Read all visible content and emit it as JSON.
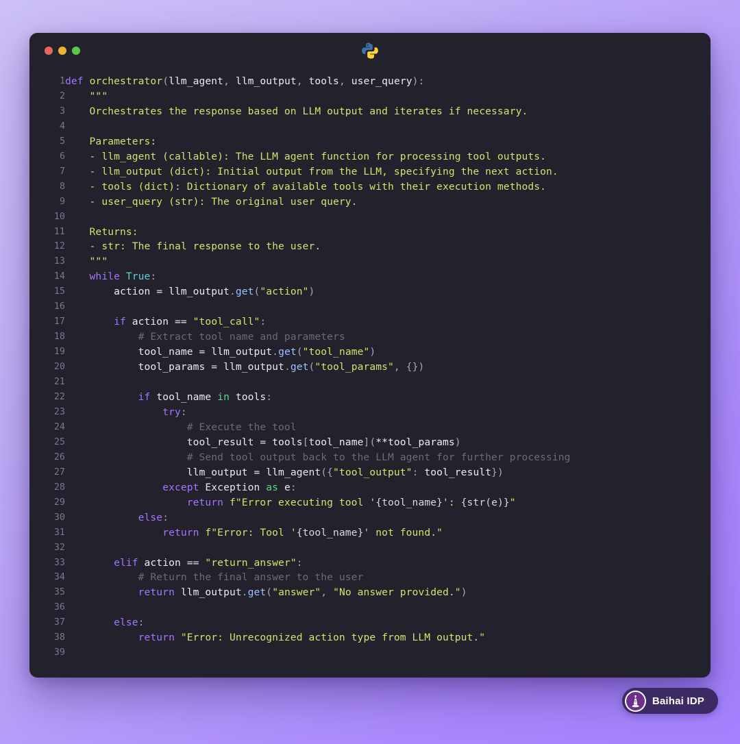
{
  "window": {
    "title_logo": "python-logo",
    "traffic_lights": [
      {
        "name": "close-button",
        "color": "#e9665f"
      },
      {
        "name": "minimize-button",
        "color": "#f0b232"
      },
      {
        "name": "maximize-button",
        "color": "#5bc745"
      }
    ]
  },
  "theme": {
    "background_gradient_from": "#ccc0f7",
    "background_gradient_to": "#a382fd",
    "window_background": "#22212c",
    "keyword_color": "#a277ff",
    "string_color": "#d6e26b",
    "comment_color": "#6d6a7c",
    "text_color": "#e2e0ea",
    "line_number_color": "#7b7990"
  },
  "watermark": {
    "label": "Baihai IDP",
    "icon": "lighthouse-icon",
    "pill_color": "#3b2a63"
  },
  "editor": {
    "language": "python",
    "total_lines": 39,
    "lines": [
      {
        "n": 1,
        "tokens": [
          {
            "t": "def",
            "c": "kw"
          },
          {
            "t": " ",
            "c": "var"
          },
          {
            "t": "orchestrator",
            "c": "fn"
          },
          {
            "t": "(",
            "c": "pun"
          },
          {
            "t": "llm_agent",
            "c": "var"
          },
          {
            "t": ", ",
            "c": "pun"
          },
          {
            "t": "llm_output",
            "c": "var"
          },
          {
            "t": ", ",
            "c": "pun"
          },
          {
            "t": "tools",
            "c": "var"
          },
          {
            "t": ", ",
            "c": "pun"
          },
          {
            "t": "user_query",
            "c": "var"
          },
          {
            "t": ")",
            "c": "pun"
          },
          {
            "t": ":",
            "c": "pun"
          }
        ]
      },
      {
        "n": 2,
        "tokens": [
          {
            "t": "    \"\"\"",
            "c": "str"
          }
        ]
      },
      {
        "n": 3,
        "tokens": [
          {
            "t": "    Orchestrates the response based on LLM output and iterates if necessary.",
            "c": "str"
          }
        ]
      },
      {
        "n": 4,
        "tokens": [
          {
            "t": "",
            "c": "str"
          }
        ]
      },
      {
        "n": 5,
        "tokens": [
          {
            "t": "    Parameters:",
            "c": "str"
          }
        ]
      },
      {
        "n": 6,
        "tokens": [
          {
            "t": "    - llm_agent (callable): The LLM agent function for processing tool outputs.",
            "c": "str"
          }
        ]
      },
      {
        "n": 7,
        "tokens": [
          {
            "t": "    - llm_output (dict): Initial output from the LLM, specifying the next action.",
            "c": "str"
          }
        ]
      },
      {
        "n": 8,
        "tokens": [
          {
            "t": "    - tools (dict): Dictionary of available tools with their execution methods.",
            "c": "str"
          }
        ]
      },
      {
        "n": 9,
        "tokens": [
          {
            "t": "    - user_query (str): The original user query.",
            "c": "str"
          }
        ]
      },
      {
        "n": 10,
        "tokens": [
          {
            "t": "",
            "c": "str"
          }
        ]
      },
      {
        "n": 11,
        "tokens": [
          {
            "t": "    Returns:",
            "c": "str"
          }
        ]
      },
      {
        "n": 12,
        "tokens": [
          {
            "t": "    - str: The final response to the user.",
            "c": "str"
          }
        ]
      },
      {
        "n": 13,
        "tokens": [
          {
            "t": "    \"\"\"",
            "c": "str"
          }
        ]
      },
      {
        "n": 14,
        "tokens": [
          {
            "t": "    ",
            "c": "var"
          },
          {
            "t": "while",
            "c": "kw"
          },
          {
            "t": " ",
            "c": "var"
          },
          {
            "t": "True",
            "c": "bi"
          },
          {
            "t": ":",
            "c": "pun"
          }
        ]
      },
      {
        "n": 15,
        "tokens": [
          {
            "t": "        ",
            "c": "var"
          },
          {
            "t": "action",
            "c": "var"
          },
          {
            "t": " ",
            "c": "var"
          },
          {
            "t": "=",
            "c": "op"
          },
          {
            "t": " ",
            "c": "var"
          },
          {
            "t": "llm_output",
            "c": "var"
          },
          {
            "t": ".",
            "c": "pun"
          },
          {
            "t": "get",
            "c": "meth"
          },
          {
            "t": "(",
            "c": "pun"
          },
          {
            "t": "\"action\"",
            "c": "str"
          },
          {
            "t": ")",
            "c": "pun"
          }
        ]
      },
      {
        "n": 16,
        "tokens": [
          {
            "t": "",
            "c": "var"
          }
        ]
      },
      {
        "n": 17,
        "tokens": [
          {
            "t": "        ",
            "c": "var"
          },
          {
            "t": "if",
            "c": "kw"
          },
          {
            "t": " ",
            "c": "var"
          },
          {
            "t": "action",
            "c": "var"
          },
          {
            "t": " ",
            "c": "var"
          },
          {
            "t": "==",
            "c": "op"
          },
          {
            "t": " ",
            "c": "var"
          },
          {
            "t": "\"tool_call\"",
            "c": "str"
          },
          {
            "t": ":",
            "c": "pun"
          }
        ]
      },
      {
        "n": 18,
        "tokens": [
          {
            "t": "            # Extract tool name and parameters",
            "c": "com"
          }
        ]
      },
      {
        "n": 19,
        "tokens": [
          {
            "t": "            ",
            "c": "var"
          },
          {
            "t": "tool_name",
            "c": "var"
          },
          {
            "t": " ",
            "c": "var"
          },
          {
            "t": "=",
            "c": "op"
          },
          {
            "t": " ",
            "c": "var"
          },
          {
            "t": "llm_output",
            "c": "var"
          },
          {
            "t": ".",
            "c": "pun"
          },
          {
            "t": "get",
            "c": "meth"
          },
          {
            "t": "(",
            "c": "pun"
          },
          {
            "t": "\"tool_name\"",
            "c": "str"
          },
          {
            "t": ")",
            "c": "pun"
          }
        ]
      },
      {
        "n": 20,
        "tokens": [
          {
            "t": "            ",
            "c": "var"
          },
          {
            "t": "tool_params",
            "c": "var"
          },
          {
            "t": " ",
            "c": "var"
          },
          {
            "t": "=",
            "c": "op"
          },
          {
            "t": " ",
            "c": "var"
          },
          {
            "t": "llm_output",
            "c": "var"
          },
          {
            "t": ".",
            "c": "pun"
          },
          {
            "t": "get",
            "c": "meth"
          },
          {
            "t": "(",
            "c": "pun"
          },
          {
            "t": "\"tool_params\"",
            "c": "str"
          },
          {
            "t": ", ",
            "c": "pun"
          },
          {
            "t": "{}",
            "c": "pun"
          },
          {
            "t": ")",
            "c": "pun"
          }
        ]
      },
      {
        "n": 21,
        "tokens": [
          {
            "t": "",
            "c": "var"
          }
        ]
      },
      {
        "n": 22,
        "tokens": [
          {
            "t": "            ",
            "c": "var"
          },
          {
            "t": "if",
            "c": "kw"
          },
          {
            "t": " ",
            "c": "var"
          },
          {
            "t": "tool_name",
            "c": "var"
          },
          {
            "t": " ",
            "c": "var"
          },
          {
            "t": "in",
            "c": "kw2"
          },
          {
            "t": " ",
            "c": "var"
          },
          {
            "t": "tools",
            "c": "var"
          },
          {
            "t": ":",
            "c": "pun"
          }
        ]
      },
      {
        "n": 23,
        "tokens": [
          {
            "t": "                ",
            "c": "var"
          },
          {
            "t": "try",
            "c": "kw"
          },
          {
            "t": ":",
            "c": "pun"
          }
        ]
      },
      {
        "n": 24,
        "tokens": [
          {
            "t": "                    # Execute the tool",
            "c": "com"
          }
        ]
      },
      {
        "n": 25,
        "tokens": [
          {
            "t": "                    ",
            "c": "var"
          },
          {
            "t": "tool_result",
            "c": "var"
          },
          {
            "t": " ",
            "c": "var"
          },
          {
            "t": "=",
            "c": "op"
          },
          {
            "t": " ",
            "c": "var"
          },
          {
            "t": "tools",
            "c": "var"
          },
          {
            "t": "[",
            "c": "pun"
          },
          {
            "t": "tool_name",
            "c": "var"
          },
          {
            "t": "]",
            "c": "pun"
          },
          {
            "t": "(",
            "c": "pun"
          },
          {
            "t": "**",
            "c": "op"
          },
          {
            "t": "tool_params",
            "c": "var"
          },
          {
            "t": ")",
            "c": "pun"
          }
        ]
      },
      {
        "n": 26,
        "tokens": [
          {
            "t": "                    # Send tool output back to the LLM agent for further processing",
            "c": "com"
          }
        ]
      },
      {
        "n": 27,
        "tokens": [
          {
            "t": "                    ",
            "c": "var"
          },
          {
            "t": "llm_output",
            "c": "var"
          },
          {
            "t": " ",
            "c": "var"
          },
          {
            "t": "=",
            "c": "op"
          },
          {
            "t": " ",
            "c": "var"
          },
          {
            "t": "llm_agent",
            "c": "var"
          },
          {
            "t": "({",
            "c": "pun"
          },
          {
            "t": "\"tool_output\"",
            "c": "str"
          },
          {
            "t": ": ",
            "c": "pun"
          },
          {
            "t": "tool_result",
            "c": "var"
          },
          {
            "t": "})",
            "c": "pun"
          }
        ]
      },
      {
        "n": 28,
        "tokens": [
          {
            "t": "                ",
            "c": "var"
          },
          {
            "t": "except",
            "c": "kw"
          },
          {
            "t": " ",
            "c": "var"
          },
          {
            "t": "Exception",
            "c": "cls"
          },
          {
            "t": " ",
            "c": "var"
          },
          {
            "t": "as",
            "c": "kw2"
          },
          {
            "t": " ",
            "c": "var"
          },
          {
            "t": "e",
            "c": "var"
          },
          {
            "t": ":",
            "c": "pun"
          }
        ]
      },
      {
        "n": 29,
        "tokens": [
          {
            "t": "                    ",
            "c": "var"
          },
          {
            "t": "return",
            "c": "kw"
          },
          {
            "t": " ",
            "c": "var"
          },
          {
            "t": "f\"Error executing tool '",
            "c": "str"
          },
          {
            "t": "{tool_name}",
            "c": "fexp"
          },
          {
            "t": "': ",
            "c": "str"
          },
          {
            "t": "{str(e)}",
            "c": "fexp"
          },
          {
            "t": "\"",
            "c": "str"
          }
        ]
      },
      {
        "n": 30,
        "tokens": [
          {
            "t": "            ",
            "c": "var"
          },
          {
            "t": "else",
            "c": "kw"
          },
          {
            "t": ":",
            "c": "pun"
          }
        ]
      },
      {
        "n": 31,
        "tokens": [
          {
            "t": "                ",
            "c": "var"
          },
          {
            "t": "return",
            "c": "kw"
          },
          {
            "t": " ",
            "c": "var"
          },
          {
            "t": "f\"Error: Tool '",
            "c": "str"
          },
          {
            "t": "{tool_name}",
            "c": "fexp"
          },
          {
            "t": "' not found.\"",
            "c": "str"
          }
        ]
      },
      {
        "n": 32,
        "tokens": [
          {
            "t": "",
            "c": "var"
          }
        ]
      },
      {
        "n": 33,
        "tokens": [
          {
            "t": "        ",
            "c": "var"
          },
          {
            "t": "elif",
            "c": "kw"
          },
          {
            "t": " ",
            "c": "var"
          },
          {
            "t": "action",
            "c": "var"
          },
          {
            "t": " ",
            "c": "var"
          },
          {
            "t": "==",
            "c": "op"
          },
          {
            "t": " ",
            "c": "var"
          },
          {
            "t": "\"return_answer\"",
            "c": "str"
          },
          {
            "t": ":",
            "c": "pun"
          }
        ]
      },
      {
        "n": 34,
        "tokens": [
          {
            "t": "            # Return the final answer to the user",
            "c": "com"
          }
        ]
      },
      {
        "n": 35,
        "tokens": [
          {
            "t": "            ",
            "c": "var"
          },
          {
            "t": "return",
            "c": "kw"
          },
          {
            "t": " ",
            "c": "var"
          },
          {
            "t": "llm_output",
            "c": "var"
          },
          {
            "t": ".",
            "c": "pun"
          },
          {
            "t": "get",
            "c": "meth"
          },
          {
            "t": "(",
            "c": "pun"
          },
          {
            "t": "\"answer\"",
            "c": "str"
          },
          {
            "t": ", ",
            "c": "pun"
          },
          {
            "t": "\"No answer provided.\"",
            "c": "str"
          },
          {
            "t": ")",
            "c": "pun"
          }
        ]
      },
      {
        "n": 36,
        "tokens": [
          {
            "t": "",
            "c": "var"
          }
        ]
      },
      {
        "n": 37,
        "tokens": [
          {
            "t": "        ",
            "c": "var"
          },
          {
            "t": "else",
            "c": "kw"
          },
          {
            "t": ":",
            "c": "pun"
          }
        ]
      },
      {
        "n": 38,
        "tokens": [
          {
            "t": "            ",
            "c": "var"
          },
          {
            "t": "return",
            "c": "kw"
          },
          {
            "t": " ",
            "c": "var"
          },
          {
            "t": "\"Error: Unrecognized action type from LLM output.\"",
            "c": "str"
          }
        ]
      },
      {
        "n": 39,
        "tokens": [
          {
            "t": "",
            "c": "var"
          }
        ]
      }
    ]
  }
}
